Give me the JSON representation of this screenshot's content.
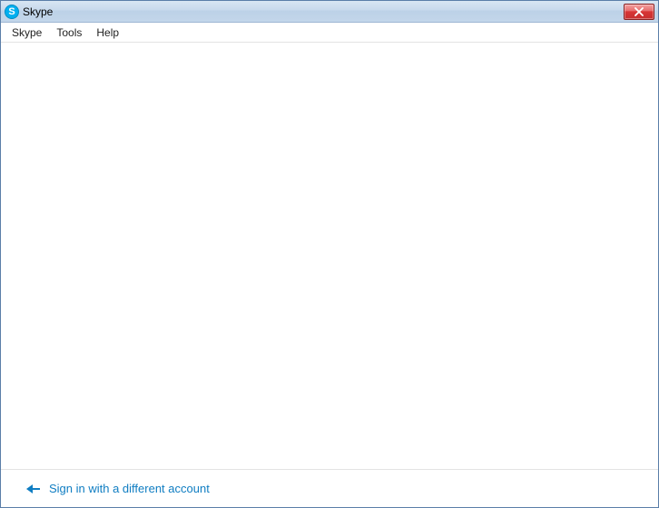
{
  "titlebar": {
    "app_icon_letter": "S",
    "title": "Skype"
  },
  "menubar": {
    "items": [
      "Skype",
      "Tools",
      "Help"
    ]
  },
  "footer": {
    "signin_link_text": "Sign in with a different account"
  }
}
